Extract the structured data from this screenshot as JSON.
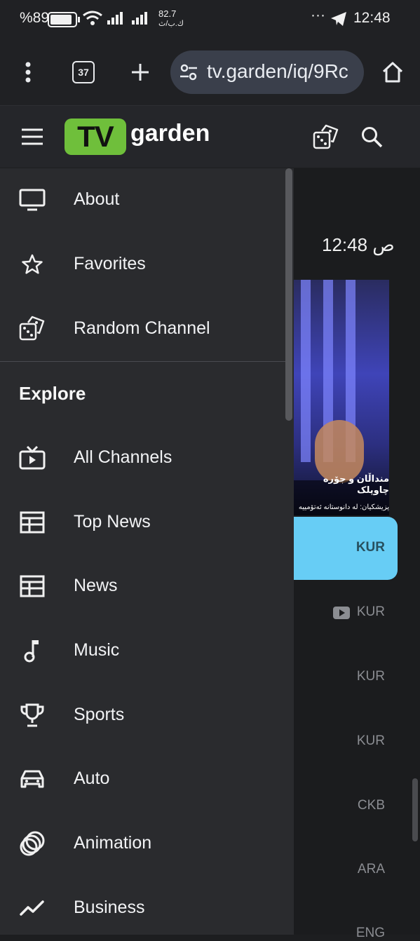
{
  "status_bar": {
    "battery": "%89",
    "net_speed": "82.7",
    "net_unit": "ك.ب/ث",
    "more": "···",
    "time": "12:48"
  },
  "browser": {
    "tab_count": "37",
    "url": "tv.garden/iq/9Rc"
  },
  "app": {
    "logo_box": "TV",
    "logo_word": "garden"
  },
  "drawer": {
    "items": [
      {
        "label": "About",
        "icon": "monitor-icon"
      },
      {
        "label": "Favorites",
        "icon": "star-icon"
      },
      {
        "label": "Random Channel",
        "icon": "dice-icon"
      }
    ],
    "section_title": "Explore",
    "explore": [
      {
        "label": "All Channels",
        "icon": "tv-icon"
      },
      {
        "label": "Top News",
        "icon": "newspaper-icon"
      },
      {
        "label": "News",
        "icon": "newspaper-icon"
      },
      {
        "label": "Music",
        "icon": "music-note-icon"
      },
      {
        "label": "Sports",
        "icon": "trophy-icon"
      },
      {
        "label": "Auto",
        "icon": "car-icon"
      },
      {
        "label": "Animation",
        "icon": "animation-icon"
      },
      {
        "label": "Business",
        "icon": "trending-up-icon"
      }
    ]
  },
  "background": {
    "clock": "12:48 ص",
    "video_caption_1": "منداڵان و جۆرە چاوپلک",
    "video_caption_2": "پزیشکیان: لە دانوستانە ئەتۆمییە",
    "selected_lang": "KUR",
    "langs": [
      "KUR",
      "KUR",
      "KUR",
      "CKB",
      "ARA",
      "ENG"
    ]
  },
  "colors": {
    "accent_logo": "#6fbf3b",
    "selected_pill": "#67cdf5",
    "drawer_bg": "#2a2b2e"
  }
}
